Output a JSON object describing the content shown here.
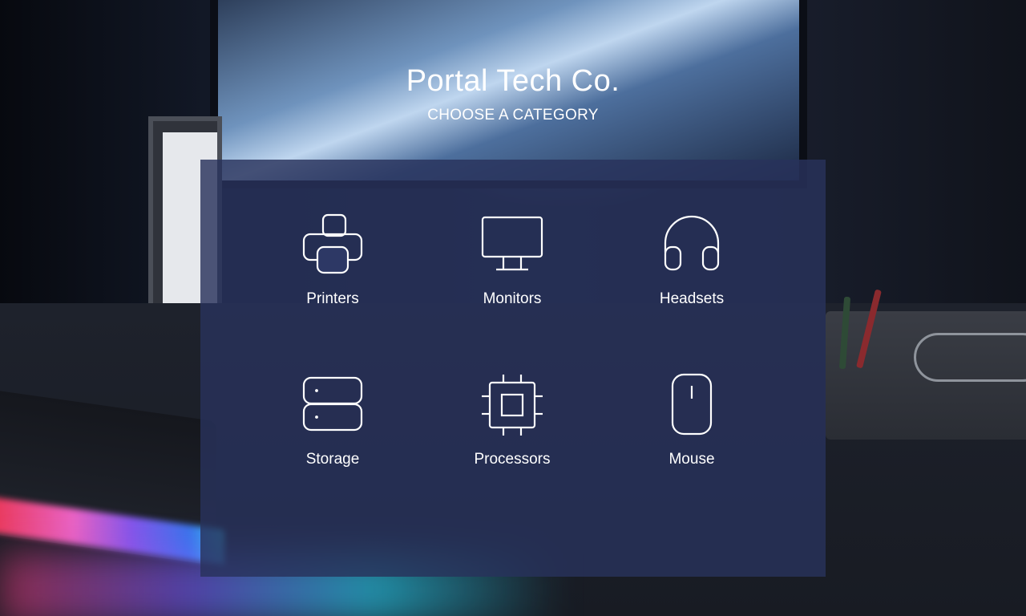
{
  "header": {
    "title": "Portal Tech Co.",
    "subtitle": "CHOOSE A CATEGORY"
  },
  "categories": [
    {
      "label": "Printers",
      "icon": "printer-icon"
    },
    {
      "label": "Monitors",
      "icon": "monitor-icon"
    },
    {
      "label": "Headsets",
      "icon": "headset-icon"
    },
    {
      "label": "Storage",
      "icon": "storage-icon"
    },
    {
      "label": "Processors",
      "icon": "processor-icon"
    },
    {
      "label": "Mouse",
      "icon": "mouse-icon"
    }
  ],
  "colors": {
    "panel": "#28325c",
    "text": "#ffffff"
  }
}
